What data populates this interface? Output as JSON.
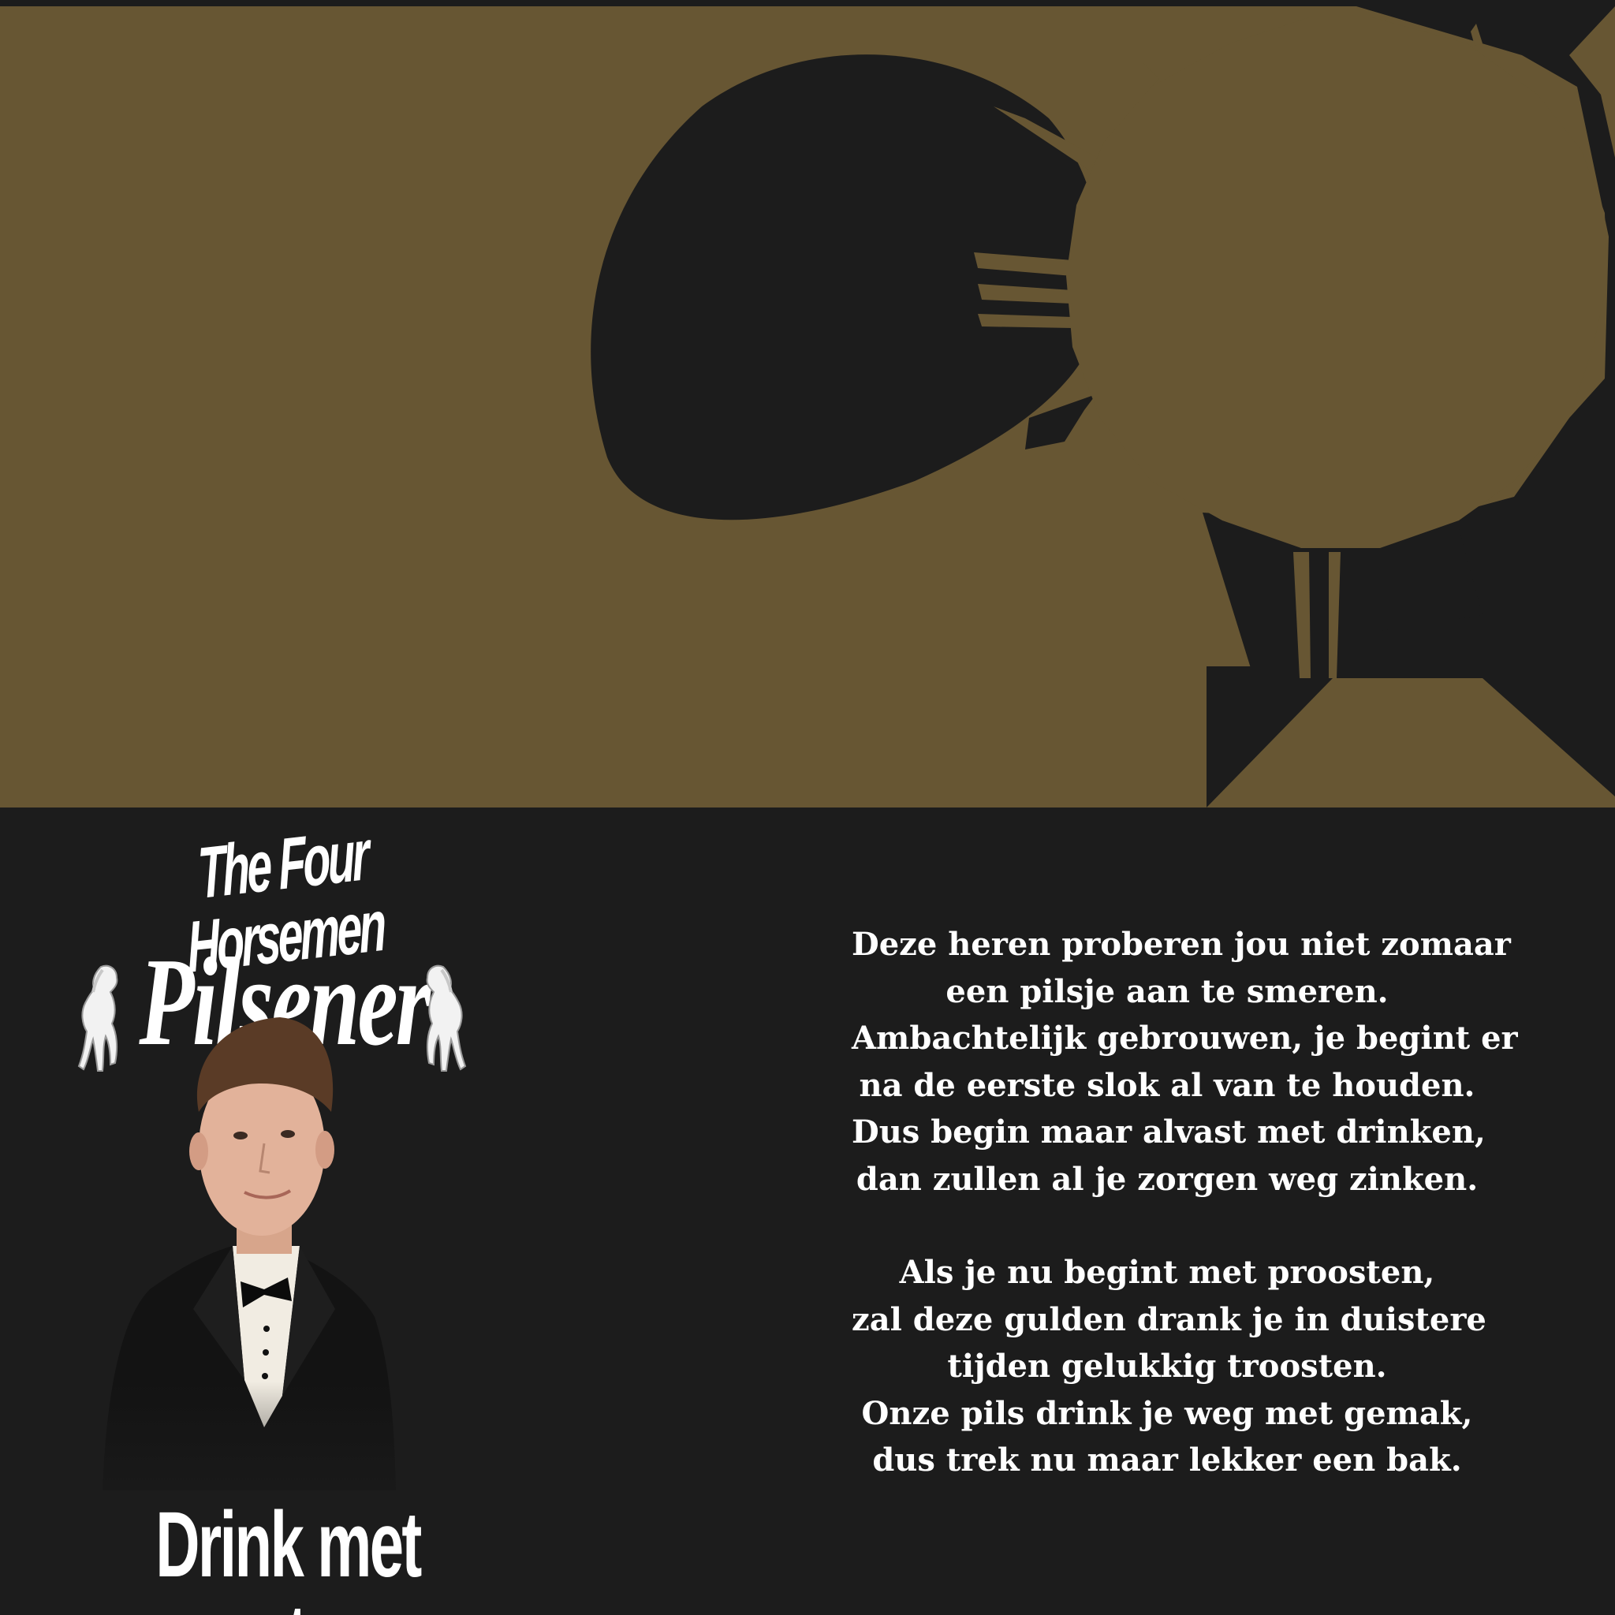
{
  "colors": {
    "background": "#1c1c1c",
    "gold": "#675633",
    "text": "#ffffff"
  },
  "brand": {
    "title": "The Four Horsemen",
    "subtitle": "Pilsener",
    "slogan": "Drink met maten"
  },
  "icons": [
    "white-horse-icon",
    "white-horse-icon"
  ],
  "poem": {
    "stanza1": [
      "Deze heren proberen jou niet zomaar",
      "een pilsje aan te smeren.",
      "Ambachtelijk gebrouwen, je begint er",
      "na de eerste slok al van te houden.",
      "Dus begin maar alvast met drinken,",
      "dan zullen al je zorgen weg zinken."
    ],
    "stanza2": [
      "Als je nu begint met proosten,",
      "zal deze gulden drank je in duistere",
      "tijden gelukkig troosten.",
      "Onze pils drink je weg met gemak,",
      "dus trek nu maar lekker een bak."
    ]
  }
}
